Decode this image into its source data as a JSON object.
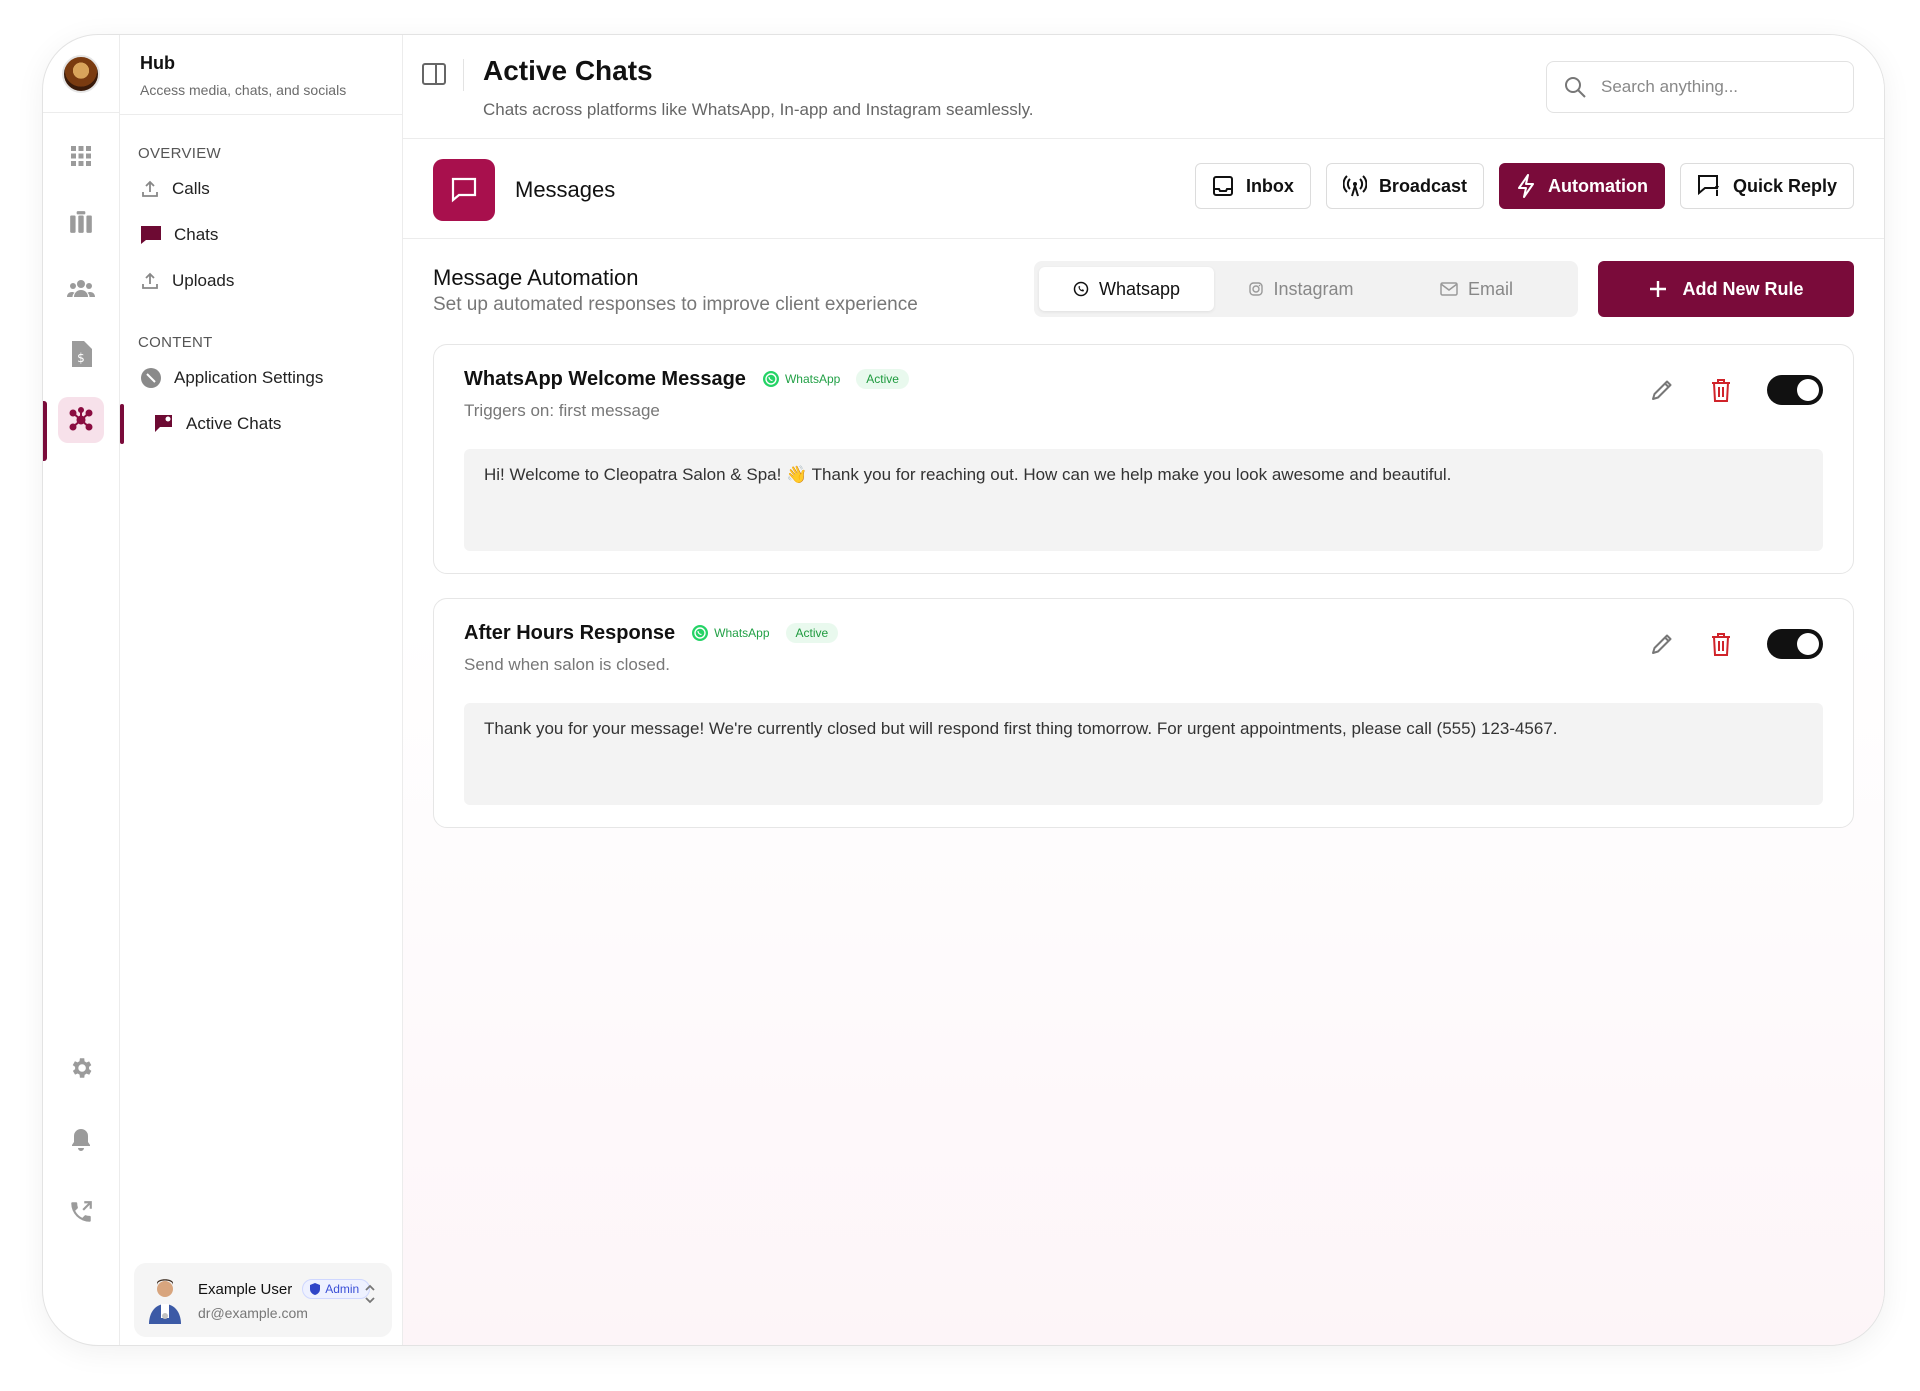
{
  "sidebar": {
    "title": "Hub",
    "subtitle": "Access media, chats, and socials",
    "sections": [
      {
        "label": "OVERVIEW",
        "items": [
          {
            "label": "Calls",
            "icon": "upload-icon"
          },
          {
            "label": "Chats",
            "icon": "chat-bubble-icon"
          },
          {
            "label": "Uploads",
            "icon": "upload-icon"
          }
        ]
      },
      {
        "label": "CONTENT",
        "items": [
          {
            "label": "Application Settings",
            "icon": "settings-circle-icon"
          },
          {
            "label": "Active Chats",
            "icon": "flag-chat-icon"
          }
        ]
      }
    ],
    "user": {
      "name": "Example User",
      "role": "Admin",
      "email": "dr@example.com"
    }
  },
  "header": {
    "title": "Active Chats",
    "subtitle": "Chats across platforms like WhatsApp, In-app and Instagram seamlessly.",
    "search_placeholder": "Search anything..."
  },
  "messages_bar": {
    "title": "Messages",
    "buttons": [
      {
        "label": "Inbox",
        "icon": "inbox-icon"
      },
      {
        "label": "Broadcast",
        "icon": "broadcast-icon"
      },
      {
        "label": "Automation",
        "icon": "bolt-icon",
        "active": true
      },
      {
        "label": "Quick Reply",
        "icon": "quick-reply-icon"
      }
    ]
  },
  "automation": {
    "title": "Message Automation",
    "subtitle": "Set up automated responses to improve client experience",
    "tabs": [
      {
        "label": "Whatsapp",
        "active": true
      },
      {
        "label": "Instagram",
        "active": false
      },
      {
        "label": "Email",
        "active": false
      }
    ],
    "add_rule_label": "Add New Rule",
    "rules": [
      {
        "title": "WhatsApp Welcome Message",
        "platform": "WhatsApp",
        "status": "Active",
        "subtitle": "Triggers on: first message",
        "message": "Hi! Welcome to Cleopatra Salon & Spa! 👋 Thank you for reaching out. How can we help make you look awesome and beautiful.",
        "enabled": true
      },
      {
        "title": "After Hours Response",
        "platform": "WhatsApp",
        "status": "Active",
        "subtitle": "Send when salon is closed.",
        "message": "Thank you for your message! We're currently closed but will respond first thing tomorrow. For urgent appointments, please call (555) 123-4567.",
        "enabled": true
      }
    ]
  },
  "colors": {
    "accent": "#7a0b3a",
    "accent_bright": "#a8104d",
    "whatsapp_green": "#25d366",
    "delete_red": "#d0232a"
  }
}
